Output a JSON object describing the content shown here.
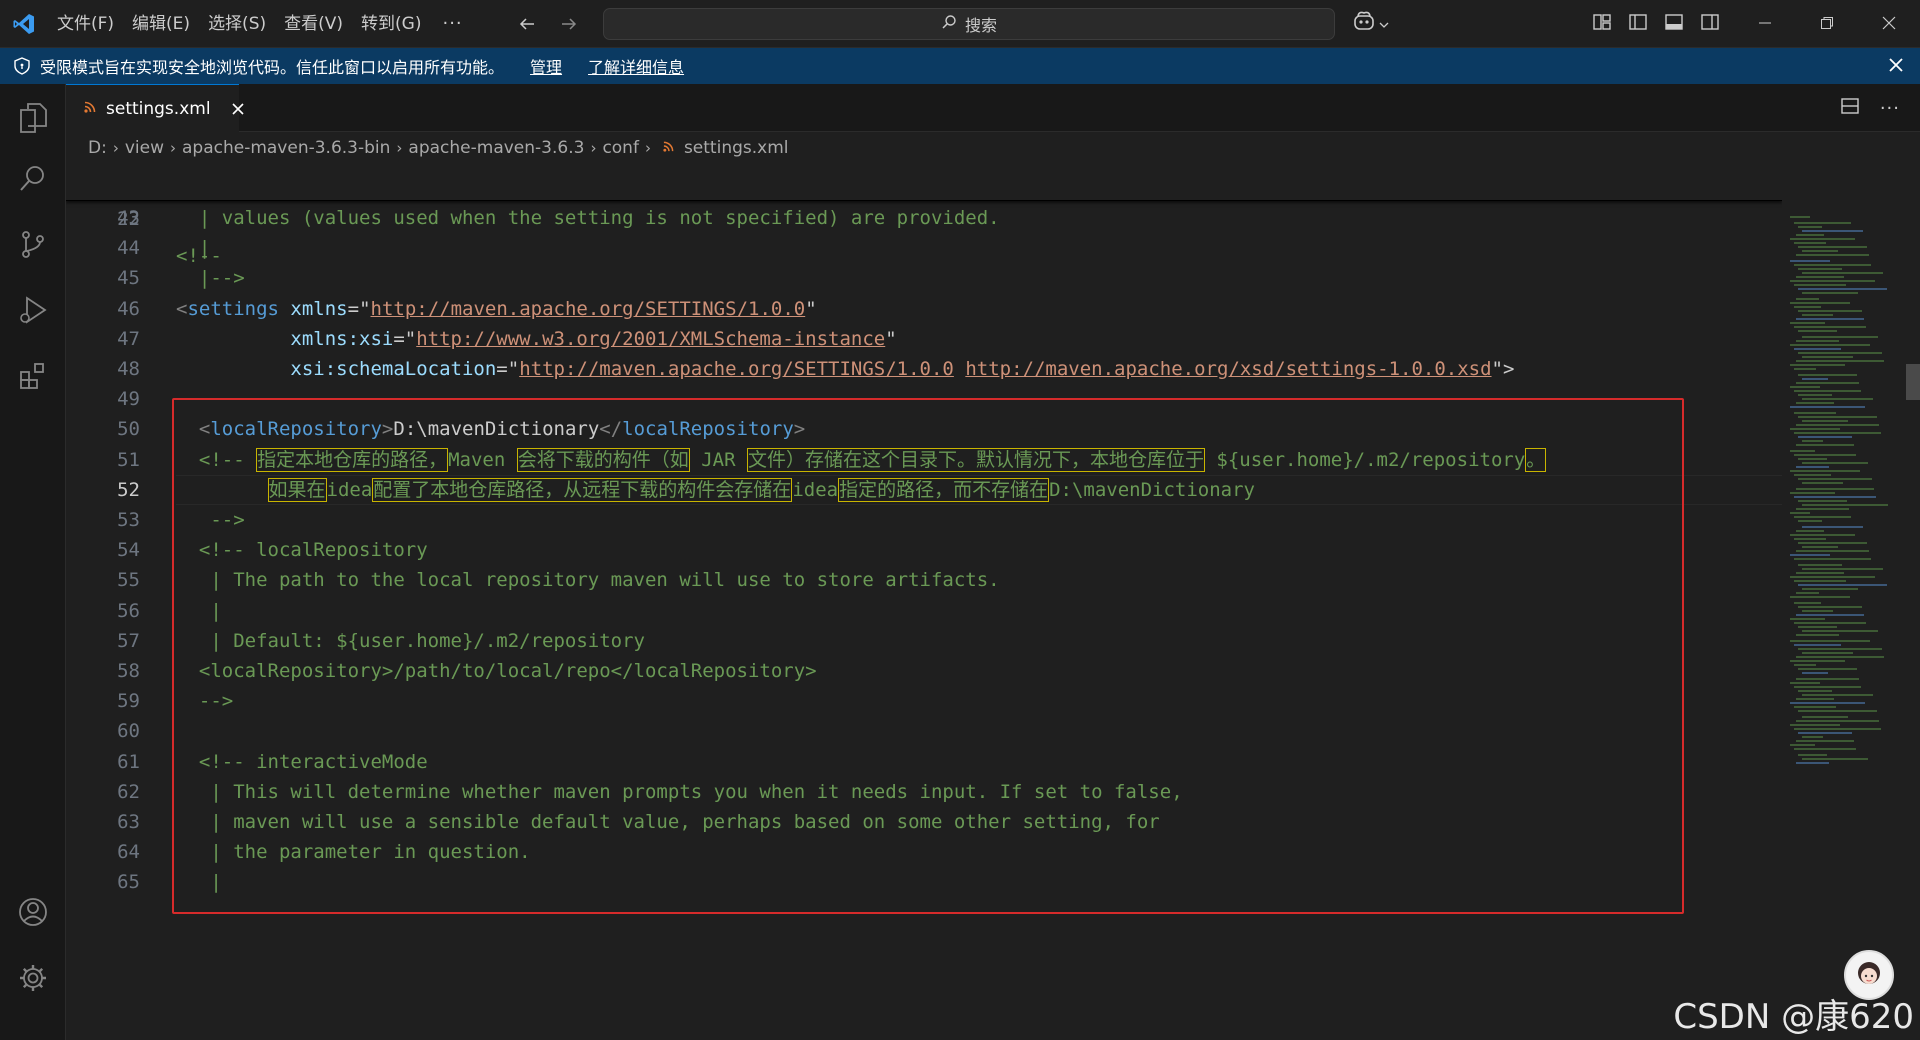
{
  "titlebar": {
    "menu": [
      "文件(F)",
      "编辑(E)",
      "选择(S)",
      "查看(V)",
      "转到(G)"
    ],
    "more": "···",
    "search_placeholder": "搜索"
  },
  "banner": {
    "message": "受限模式旨在实现安全地浏览代码。信任此窗口以启用所有功能。",
    "manage_link": "管理",
    "learn_more_link": "了解详细信息"
  },
  "tab": {
    "filename": "settings.xml",
    "icon": "rss-xml-icon"
  },
  "breadcrumb": [
    "D:",
    "view",
    "apache-maven-3.6.3-bin",
    "apache-maven-3.6.3",
    "conf",
    "settings.xml"
  ],
  "editor": {
    "sticky_line": {
      "number": "22",
      "text": "<!--"
    },
    "active_line": "52",
    "lines": [
      {
        "n": "43",
        "t": "  | values (values used when the setting is not specified) are provided."
      },
      {
        "n": "44",
        "t": "  |"
      },
      {
        "n": "45",
        "t": "  |-->"
      },
      {
        "n": "46",
        "parts": [
          [
            "<",
            "bracket"
          ],
          [
            "settings",
            "tag"
          ],
          [
            " ",
            "text"
          ],
          [
            "xmlns",
            "attr"
          ],
          [
            "=\"",
            "text"
          ],
          [
            "http://maven.apache.org/SETTINGS/1.0.0",
            "url"
          ],
          [
            "\"",
            "text"
          ]
        ]
      },
      {
        "n": "47",
        "parts": [
          [
            "          ",
            "text"
          ],
          [
            "xmlns:xsi",
            "attr"
          ],
          [
            "=\"",
            "text"
          ],
          [
            "http://www.w3.org/2001/XMLSchema-instance",
            "url"
          ],
          [
            "\"",
            "text"
          ]
        ]
      },
      {
        "n": "48",
        "parts": [
          [
            "          ",
            "text"
          ],
          [
            "xsi:schemaLocation",
            "attr"
          ],
          [
            "=\"",
            "text"
          ],
          [
            "http://maven.apache.org/SETTINGS/1.0.0",
            "url"
          ],
          [
            " ",
            "text"
          ],
          [
            "http://maven.apache.org/xsd/settings-1.0.0.xsd",
            "url"
          ],
          [
            "\">",
            "text"
          ]
        ]
      },
      {
        "n": "49",
        "t": ""
      },
      {
        "n": "50",
        "parts": [
          [
            "  <",
            "bracket"
          ],
          [
            "localRepository",
            "tag"
          ],
          [
            ">",
            "bracket"
          ],
          [
            "D:\\mavenDictionary",
            "text"
          ],
          [
            "</",
            "bracket"
          ],
          [
            "localRepository",
            "tag"
          ],
          [
            ">",
            "bracket"
          ]
        ]
      },
      {
        "n": "51",
        "parts": [
          [
            "  <!-- ",
            "comment"
          ],
          [
            "指定本地仓库的路径，",
            "hl"
          ],
          [
            "Maven ",
            "comment"
          ],
          [
            "会将下载的构件（如",
            "hl"
          ],
          [
            " JAR ",
            "comment"
          ],
          [
            "文件）存储在这个目录下。默认情况下，本地仓库位于",
            "hl"
          ],
          [
            " ${user.home}/.m2/repository",
            "comment"
          ],
          [
            "。",
            "hl"
          ]
        ]
      },
      {
        "n": "52",
        "parts": [
          [
            "        ",
            "comment"
          ],
          [
            "如果在",
            "hl"
          ],
          [
            "idea",
            "comment"
          ],
          [
            "配置了本地仓库路径，从远程下载的构件会存储在",
            "hl"
          ],
          [
            "idea",
            "comment"
          ],
          [
            "指定的路径，而不存储在",
            "hl"
          ],
          [
            "D:\\mavenDictionary",
            "comment"
          ]
        ]
      },
      {
        "n": "53",
        "t": "   -->"
      },
      {
        "n": "54",
        "t": "  <!-- localRepository"
      },
      {
        "n": "55",
        "t": "   | The path to the local repository maven will use to store artifacts."
      },
      {
        "n": "56",
        "t": "   |"
      },
      {
        "n": "57",
        "t": "   | Default: ${user.home}/.m2/repository"
      },
      {
        "n": "58",
        "t": "  <localRepository>/path/to/local/repo</localRepository>"
      },
      {
        "n": "59",
        "t": "  -->"
      },
      {
        "n": "60",
        "t": ""
      },
      {
        "n": "61",
        "t": "  <!-- interactiveMode"
      },
      {
        "n": "62",
        "t": "   | This will determine whether maven prompts you when it needs input. If set to false,"
      },
      {
        "n": "63",
        "t": "   | maven will use a sensible default value, perhaps based on some other setting, for"
      },
      {
        "n": "64",
        "t": "   | the parameter in question."
      },
      {
        "n": "65",
        "t": "   |"
      }
    ]
  },
  "watermark": "CSDN @康620",
  "colors": {
    "banner": "#0b3a62",
    "accent": "#0078d4",
    "highlight_box": "#d62b2b"
  }
}
